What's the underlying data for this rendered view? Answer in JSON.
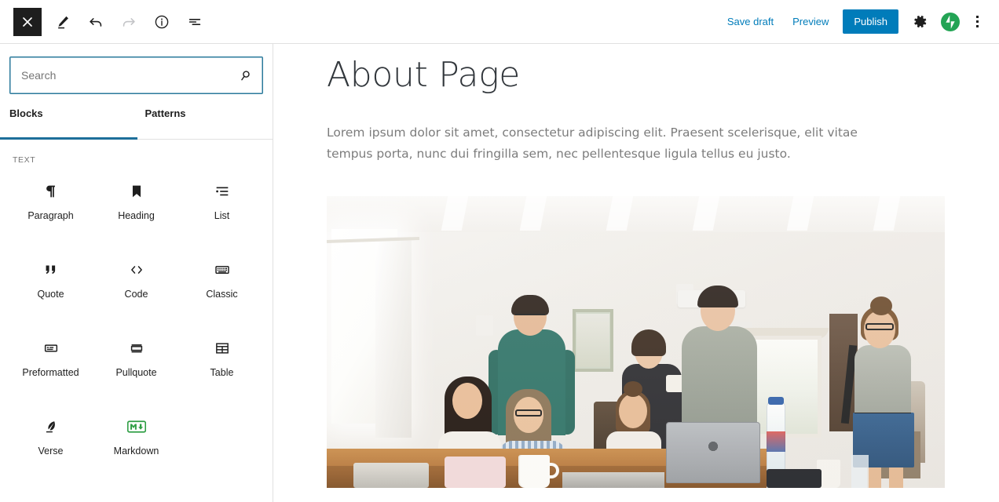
{
  "topbar": {
    "close_label": "Close",
    "close_icon": "close-x-icon",
    "tools": [
      {
        "name": "edit-pencil-icon",
        "label": "Edit",
        "disabled": false
      },
      {
        "name": "undo-icon",
        "label": "Undo",
        "disabled": false
      },
      {
        "name": "redo-icon",
        "label": "Redo",
        "disabled": true
      },
      {
        "name": "info-icon",
        "label": "Details",
        "disabled": false
      },
      {
        "name": "list-view-icon",
        "label": "List view",
        "disabled": false
      }
    ],
    "save_draft_label": "Save draft",
    "preview_label": "Preview",
    "publish_label": "Publish",
    "settings_icon": "gear-icon",
    "jetpack_icon": "jetpack-icon",
    "more_menu_icon": "ellipsis-vertical-icon",
    "accent_color": "#007cba",
    "jetpack_color": "#23a455"
  },
  "inserter": {
    "search": {
      "placeholder": "Search",
      "value": "",
      "icon": "search-icon",
      "border_color": "#2b7a9b"
    },
    "tabs": [
      {
        "label": "Blocks",
        "active": true
      },
      {
        "label": "Patterns",
        "active": false
      }
    ],
    "active_tab_underline_color": "#1e6f9a",
    "category_label": "TEXT",
    "blocks": [
      {
        "label": "Paragraph",
        "icon": "paragraph-pilcrow-icon"
      },
      {
        "label": "Heading",
        "icon": "heading-bookmark-icon"
      },
      {
        "label": "List",
        "icon": "list-icon"
      },
      {
        "label": "Quote",
        "icon": "quote-icon"
      },
      {
        "label": "Code",
        "icon": "code-angle-brackets-icon"
      },
      {
        "label": "Classic",
        "icon": "classic-keyboard-icon"
      },
      {
        "label": "Preformatted",
        "icon": "preformatted-icon"
      },
      {
        "label": "Pullquote",
        "icon": "pullquote-icon"
      },
      {
        "label": "Table",
        "icon": "table-icon"
      },
      {
        "label": "Verse",
        "icon": "verse-quill-icon"
      },
      {
        "label": "Markdown",
        "icon": "markdown-icon"
      }
    ]
  },
  "editor": {
    "post_title": "About Page",
    "paragraph": "Lorem ipsum dolor sit amet, consectetur adipiscing elit. Praesent scelerisque, elit vitae tempus porta, nunc dui fringilla sem, nec pellentesque ligula tellus eu justo.",
    "image_alt": "Group of people gathered around a table with laptops in a bright white room"
  }
}
